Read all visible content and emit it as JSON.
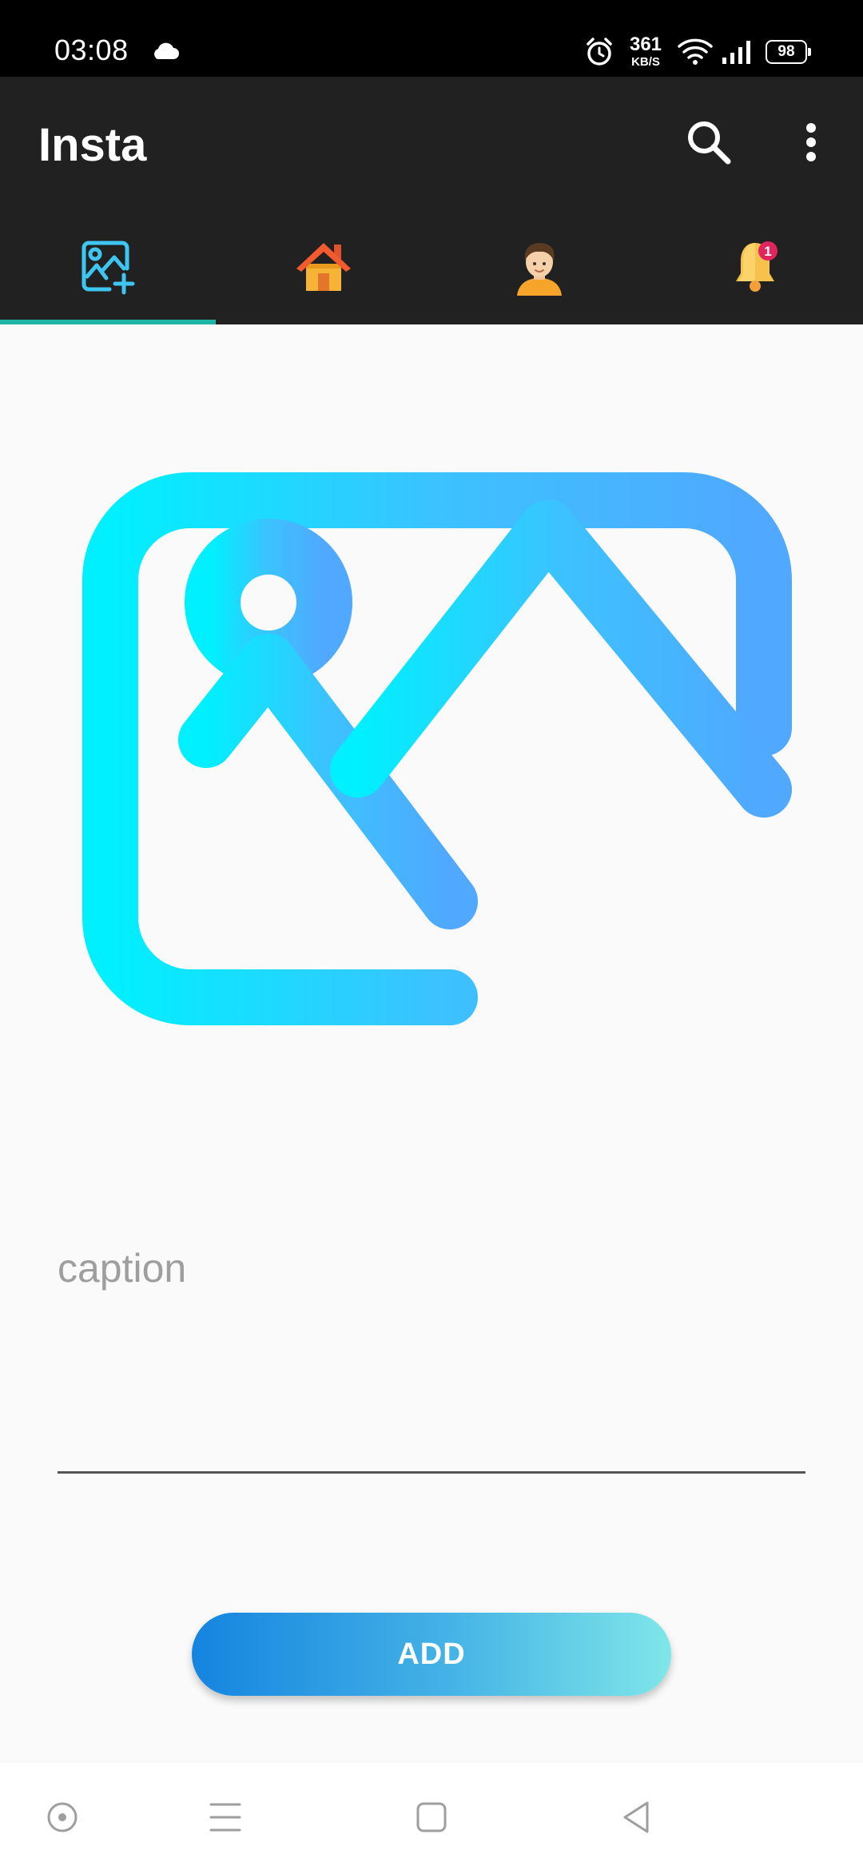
{
  "status_bar": {
    "time": "03:08",
    "net_speed": "361",
    "net_unit": "KB/S",
    "battery": "98",
    "icons": [
      "cloud-icon",
      "alarm-icon",
      "wifi-icon",
      "signal-icon",
      "battery-icon"
    ]
  },
  "app_bar": {
    "title": "Insta",
    "actions": [
      "search-icon",
      "more-vert-icon"
    ]
  },
  "tabs": [
    {
      "icon": "add-photo-icon",
      "selected": true
    },
    {
      "icon": "home-icon",
      "selected": false
    },
    {
      "icon": "profile-avatar-icon",
      "selected": false
    },
    {
      "icon": "notification-bell-icon",
      "selected": false,
      "badge": "1"
    }
  ],
  "main": {
    "image_picker_icon": "add-photo-icon",
    "caption_placeholder": "caption",
    "caption_value": "",
    "add_label": "ADD"
  },
  "nav_bar": {
    "icons": [
      "assistant-icon",
      "menu-icon",
      "home-square-icon",
      "back-triangle-icon"
    ]
  },
  "colors": {
    "app_bar": "#212121",
    "tab_indicator": "#1fb5a5",
    "icon_gradient_start": "#00f0ff",
    "icon_gradient_end": "#50a8ff",
    "button_gradient_start": "#1484e0",
    "button_gradient_end": "#7fe6e8"
  }
}
